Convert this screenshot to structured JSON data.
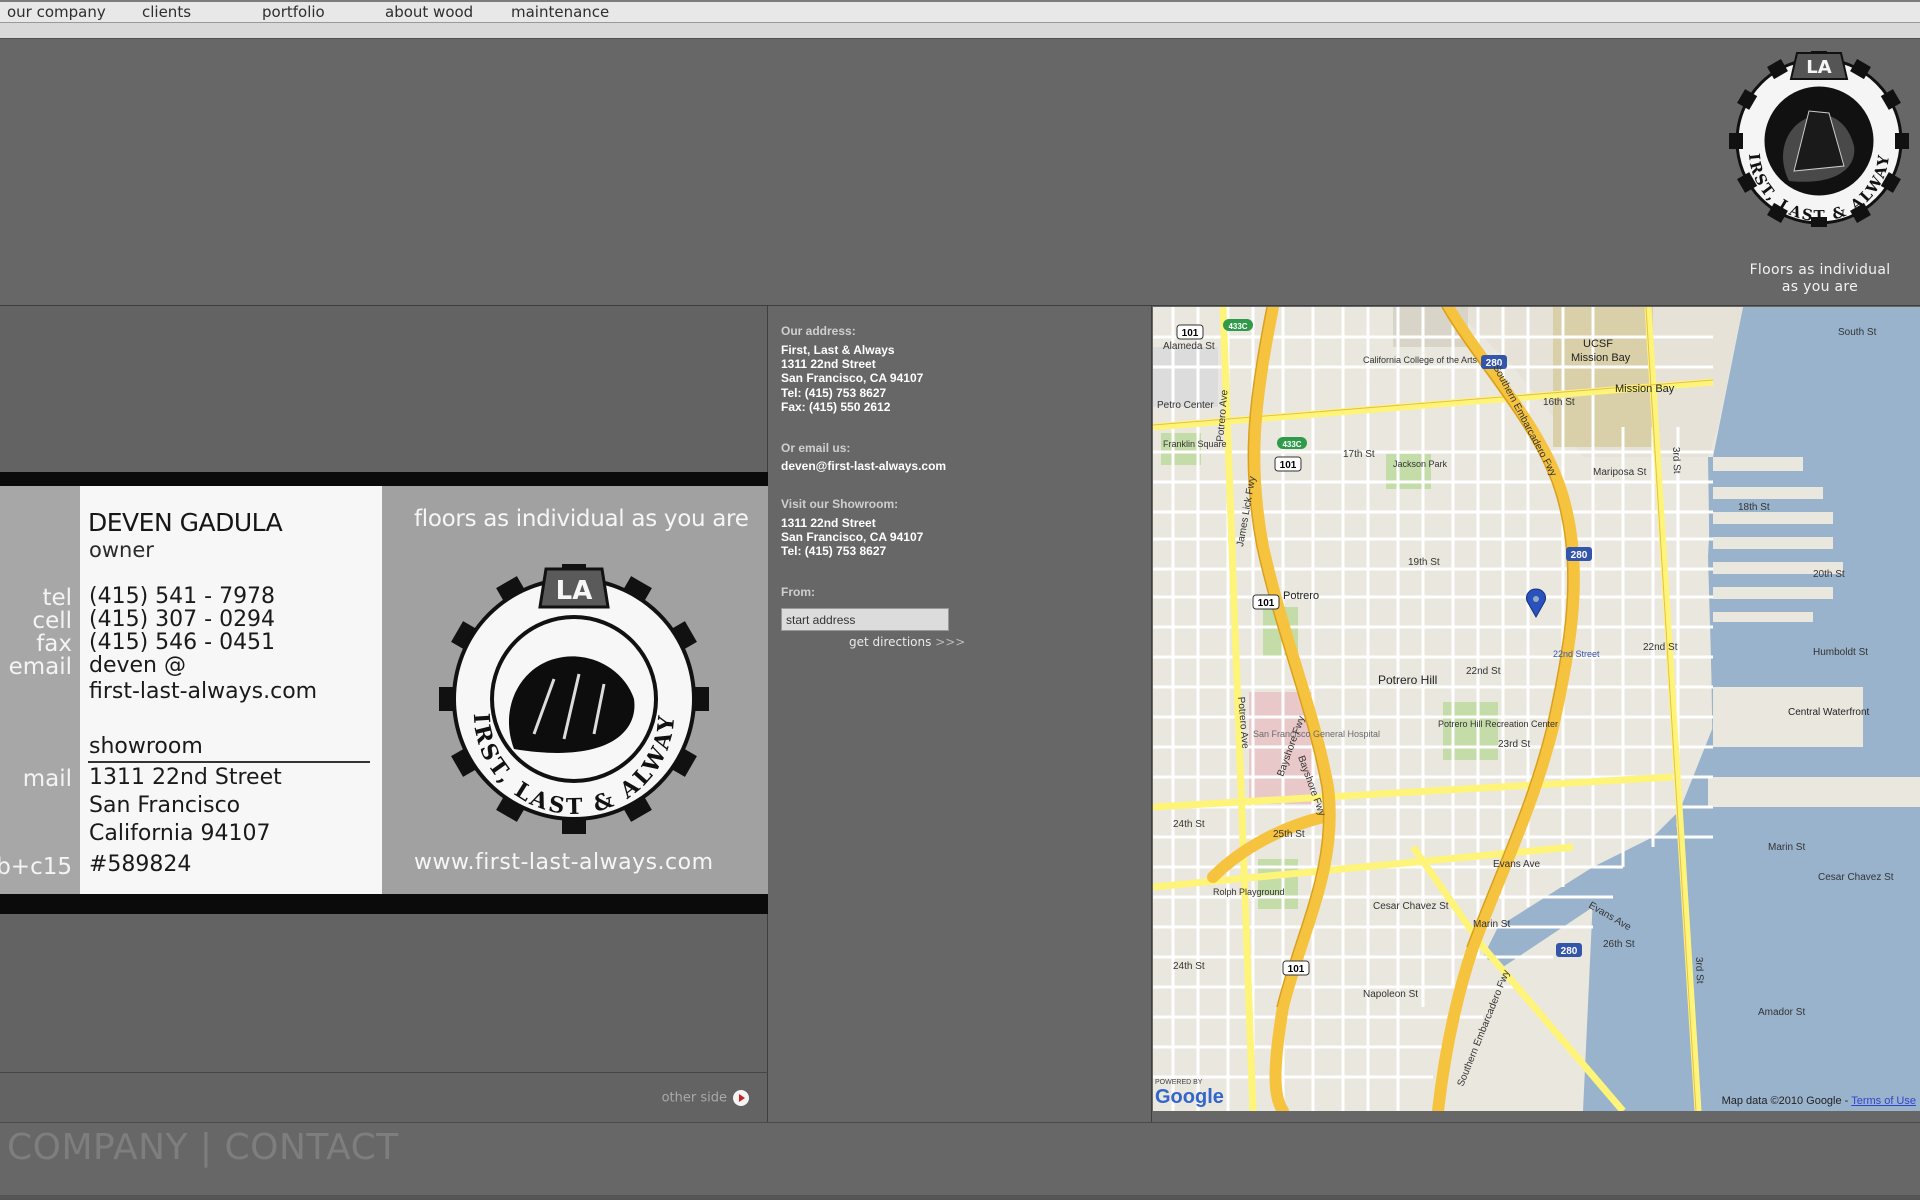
{
  "nav": {
    "items": [
      {
        "label": "our company"
      },
      {
        "label": "clients"
      },
      {
        "label": "portfolio"
      },
      {
        "label": "about wood"
      },
      {
        "label": "maintenance"
      }
    ]
  },
  "header": {
    "tagline_line1": "Floors as individual",
    "tagline_line2": "as you are",
    "logo_text": "FIRST, LAST & ALWAYS",
    "logo_monogram": "LA"
  },
  "card": {
    "name": "DEVEN GADULA",
    "role": "owner",
    "slogan": "floors as individual as you are",
    "url": "www.first-last-always.com",
    "labels": {
      "tel": "tel",
      "cell": "cell",
      "fax": "fax",
      "email": "email",
      "mail": "mail",
      "license": "b+c15"
    },
    "tel": "(415) 541 - 7978",
    "cell": "(415) 307 - 0294",
    "fax": "(415) 546 - 0451",
    "email_line1": "deven @",
    "email_line2": "first-last-always.com",
    "showroom_heading": "showroom",
    "address_line1": "1311 22nd Street",
    "address_line2": "San Francisco",
    "address_line3": "California 94107",
    "license_number": "#589824",
    "other_side": "other side"
  },
  "info": {
    "address_heading": "Our address:",
    "company": "First, Last & Always",
    "street": "1311 22nd Street",
    "city": "San Francisco, CA 94107",
    "tel": "Tel: (415) 753 8627",
    "fax": "Fax: (415) 550 2612",
    "email_heading": "Or email us:",
    "email": "deven@first-last-always.com",
    "showroom_heading": "Visit our Showroom:",
    "showroom_street": "1311 22nd Street",
    "showroom_city": "San Francisco, CA 94107",
    "showroom_tel": "Tel: (415) 753 8627",
    "from_heading": "From:",
    "from_value": "start address",
    "get_directions": "get directions",
    "get_directions_arrows": ">>>"
  },
  "map": {
    "credit": "Map data ©2010 Google -",
    "terms": "Terms of Use",
    "google_powered": "POWERED BY",
    "google_logo": "Google",
    "labels": {
      "alameda": "Alameda St",
      "sixteenth": "16th St",
      "ucsf": "UCSF",
      "mission_bay": "Mission Bay",
      "mission_bay2": "Mission Bay",
      "south_st": "South St",
      "mariposa": "Mariposa St",
      "potrero_hill": "Potrero Hill",
      "potrero": "Potrero",
      "twenty_second": "22nd St",
      "cesar_chavez": "Cesar Chavez St",
      "third_st": "3rd St",
      "potrero_ave": "Potrero Ave",
      "petro_center": "Petro Center",
      "franklin_square": "Franklin Square",
      "jackson_park": "Jackson Park",
      "california_college": "California College of the Arts",
      "sf_general": "San Francisco General Hospital",
      "potrero_rec": "Potrero Hill Recreation Center",
      "central_waterfront": "Central Waterfront",
      "rolph_playground": "Rolph Playground",
      "twenty_second_street_station": "22nd Street",
      "bayshore": "Bayshore Fwy",
      "james_lick": "James Lick Fwy",
      "southern_embarcadero": "Southern Embarcadero Fwy",
      "evans": "Evans Ave",
      "twenty_fourth": "24th St",
      "twentieth": "20th St",
      "eighteenth": "18th St",
      "seventeenth": "17th St",
      "twenty_fifth": "25th St",
      "twenty_third": "23rd St",
      "nineteenth": "19th St",
      "twenty_sixth": "26th St",
      "marin": "Marin St",
      "humboldt": "Humboldt St",
      "amador": "Amador St",
      "napoleon": "Napoleon St",
      "hwy101": "101",
      "hwy280": "280",
      "hwy433": "433C"
    }
  },
  "footer": {
    "title": "COMPANY | CONTACT"
  },
  "colors": {
    "background": "#676767",
    "map_land": "#eae7df",
    "map_water": "#99b3cc",
    "highway": "#f6c33f",
    "major_road": "#fff47a"
  }
}
